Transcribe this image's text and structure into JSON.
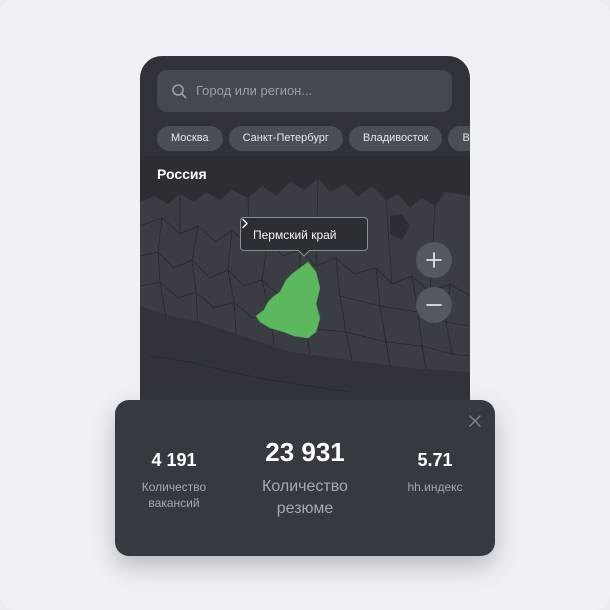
{
  "search": {
    "placeholder": "Город или регион..."
  },
  "chips": [
    "Москва",
    "Санкт-Петербург",
    "Владивосток",
    "Во"
  ],
  "map": {
    "country_title": "Россия",
    "selected_region": "Пермский край",
    "highlight_color": "#5cb85c"
  },
  "zoom": {
    "in_icon": "plus-icon",
    "out_icon": "minus-icon"
  },
  "stats": {
    "vacancies": {
      "value": "4 191",
      "label_line1": "Количество",
      "label_line2": "вакансий"
    },
    "resumes": {
      "value": "23 931",
      "label_line1": "Количество",
      "label_line2": "резюме"
    },
    "index": {
      "value": "5.71",
      "label_line1": "hh.индекс"
    }
  },
  "colors": {
    "accent": "#5cb85c",
    "panel": "#353a41",
    "map_bg": "#3a3e44"
  }
}
